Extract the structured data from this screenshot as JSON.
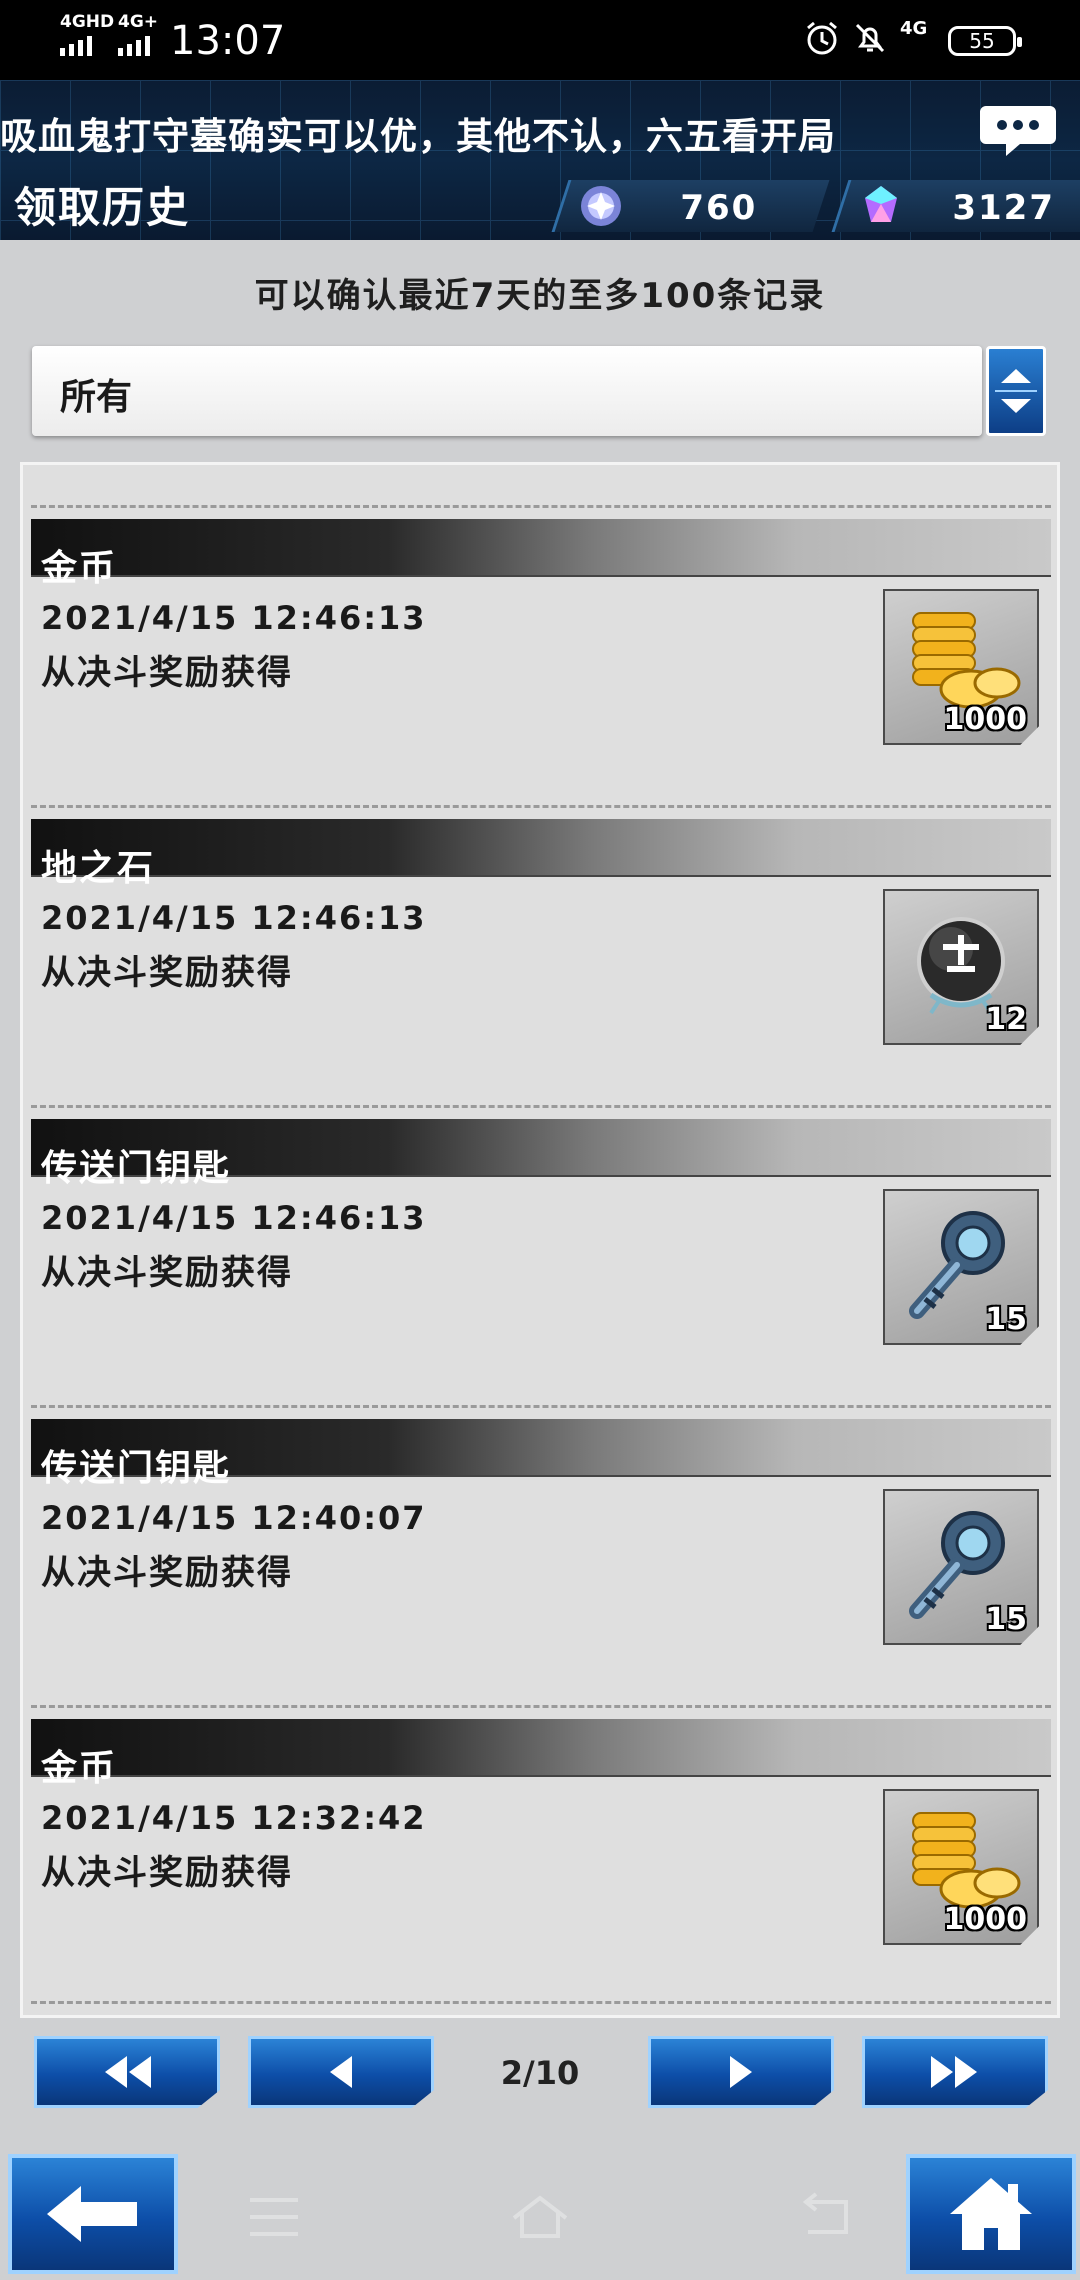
{
  "status_bar": {
    "signal_1": "4GHD",
    "signal_2": "4G+",
    "time": "13:07",
    "network": "4G",
    "battery": "55"
  },
  "header": {
    "ticker": "吸血鬼打守墓确实可以优，其他不认，六五看开局",
    "title": "领取历史",
    "currency_1_value": "760",
    "currency_2_value": "3127"
  },
  "notice": "可以确认最近7天的至多100条记录",
  "filter": {
    "selected": "所有"
  },
  "entries": [
    {
      "name": "金币",
      "date": "2021/4/15 12:46:13",
      "source": "从决斗奖励获得",
      "icon": "gold-coins-icon",
      "quantity": "1000"
    },
    {
      "name": "地之石",
      "date": "2021/4/15 12:46:13",
      "source": "从决斗奖励获得",
      "icon": "earth-orb-icon",
      "quantity": "12"
    },
    {
      "name": "传送门钥匙",
      "date": "2021/4/15 12:46:13",
      "source": "从决斗奖励获得",
      "icon": "gate-key-icon",
      "quantity": "15"
    },
    {
      "name": "传送门钥匙",
      "date": "2021/4/15 12:40:07",
      "source": "从决斗奖励获得",
      "icon": "gate-key-icon",
      "quantity": "15"
    },
    {
      "name": "金币",
      "date": "2021/4/15 12:32:42",
      "source": "从决斗奖励获得",
      "icon": "gold-coins-icon",
      "quantity": "1000"
    }
  ],
  "pager": {
    "indicator": "2/10"
  },
  "colors": {
    "accent_blue": "#0d4ea8",
    "header_bg": "#0d2744",
    "panel_bg": "#dfdfdf"
  }
}
